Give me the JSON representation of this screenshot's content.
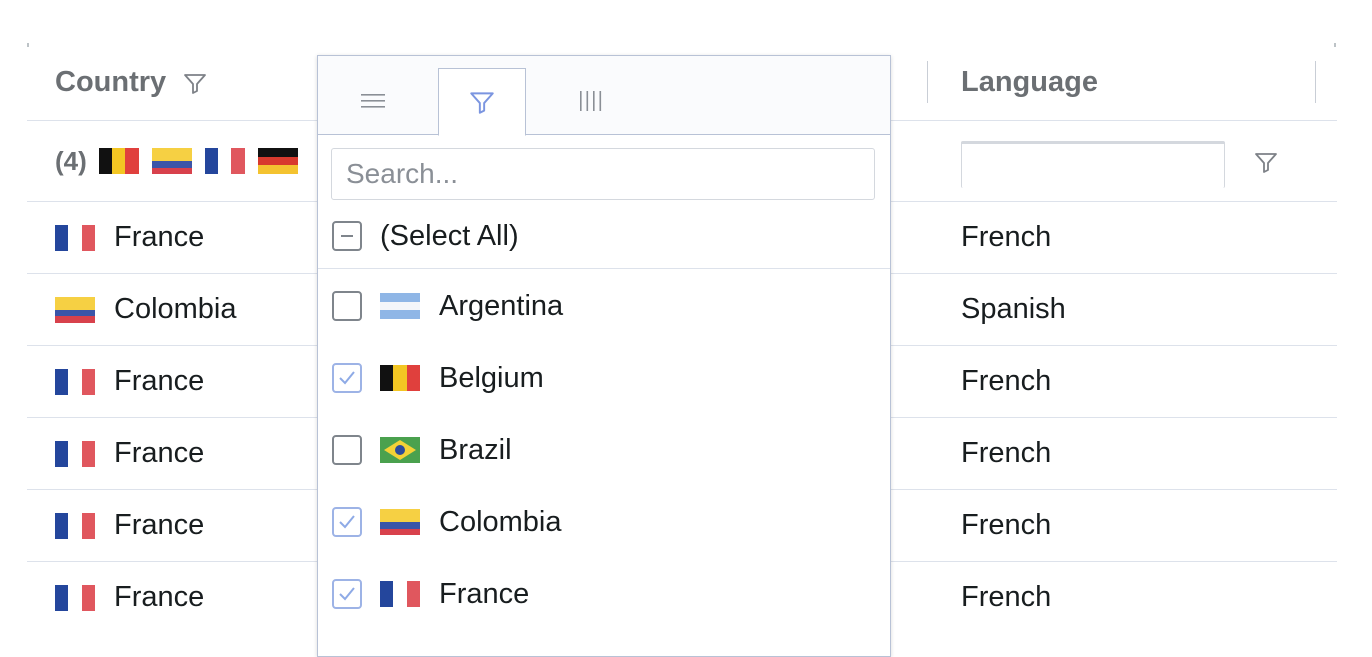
{
  "columns": {
    "country": {
      "title": "Country"
    },
    "language": {
      "title": "Language"
    }
  },
  "filter_row": {
    "country_summary": "(4)",
    "country_summary_flags": [
      "Belgium",
      "Colombia",
      "France",
      "Germany"
    ]
  },
  "rows": [
    {
      "country": "France",
      "language": "French"
    },
    {
      "country": "Colombia",
      "language": "Spanish"
    },
    {
      "country": "France",
      "language": "French"
    },
    {
      "country": "France",
      "language": "French"
    },
    {
      "country": "France",
      "language": "French"
    },
    {
      "country": "France",
      "language": "French"
    }
  ],
  "popup": {
    "tabs": [
      {
        "icon": "menu-icon",
        "active": false
      },
      {
        "icon": "filter-icon",
        "active": true
      },
      {
        "icon": "columns-icon",
        "active": false
      }
    ],
    "search": {
      "placeholder": "Search...",
      "value": ""
    },
    "select_all": {
      "label": "(Select All)",
      "state": "indeterminate"
    },
    "items": [
      {
        "label": "Argentina",
        "checked": false
      },
      {
        "label": "Belgium",
        "checked": true
      },
      {
        "label": "Brazil",
        "checked": false
      },
      {
        "label": "Colombia",
        "checked": true
      },
      {
        "label": "France",
        "checked": true
      }
    ]
  },
  "colors": {
    "header_text": "#6b6f73",
    "border": "#dde2eb",
    "popup_border": "#b8c2d6",
    "active_icon": "#7b95e0",
    "check": "#9db3e6"
  }
}
